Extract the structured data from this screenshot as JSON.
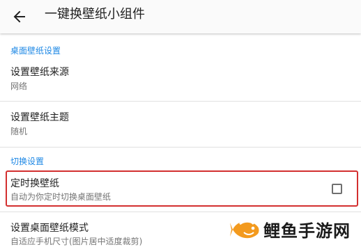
{
  "appbar": {
    "title": "一键换壁纸小组件",
    "back_icon": "arrow-left-icon"
  },
  "sections": {
    "desktop_header": "桌面壁纸设置",
    "switch_header": "切换设置"
  },
  "prefs": {
    "source": {
      "title": "设置壁纸来源",
      "summary": "网络"
    },
    "theme": {
      "title": "设置壁纸主题",
      "summary": "随机"
    },
    "timed": {
      "title": "定时换壁纸",
      "summary": "自动为你定时切换桌面壁纸",
      "checked": false
    },
    "mode": {
      "title": "设置桌面壁纸模式",
      "summary": "自适应手机尺寸(图片居中适度裁剪)"
    }
  },
  "watermark": {
    "text": "鲤鱼手游网",
    "logo_icon": "fish-logo-icon"
  },
  "colors": {
    "accent": "#1e88e5",
    "highlight_border": "#d32f2f",
    "logo_orange": "#f39a1e"
  }
}
